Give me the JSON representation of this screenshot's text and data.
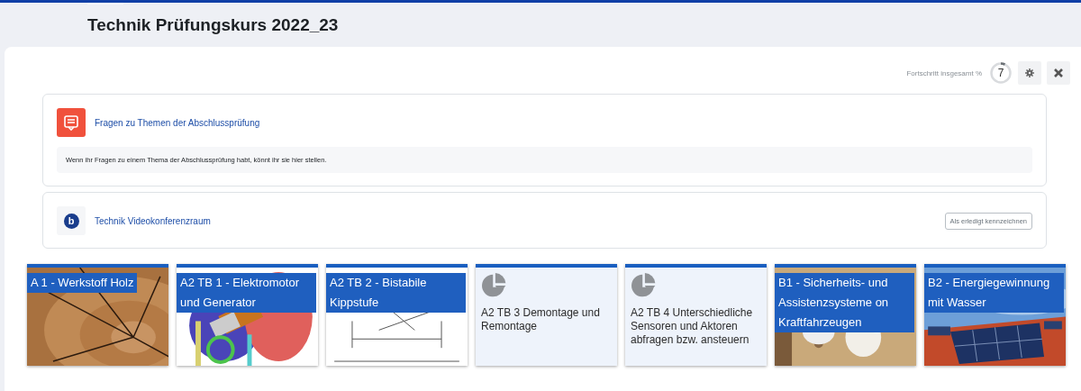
{
  "course": {
    "title": "Technik Prüfungskurs 2022_23"
  },
  "progress": {
    "label": "Fortschritt insgesamt %",
    "value": "7",
    "level": 0.07
  },
  "activities": [
    {
      "kind": "forum",
      "title": "Fragen zu Themen der Abschlussprüfung",
      "description": "Wenn ihr Fragen zu einem Thema der Abschlussprüfung habt, könnt ihr sie hier stellen."
    },
    {
      "kind": "conference",
      "icon_text": "b",
      "title": "Technik Videokonferenzraum",
      "completion_button": "Als erledigt kennzeichnen"
    }
  ],
  "sections": [
    {
      "kind": "picture",
      "title": "A 1 - Werkstoff Holz"
    },
    {
      "kind": "picture",
      "title": "A2 TB 1 - Elektromotor und Generator"
    },
    {
      "kind": "picture",
      "title": "A2 TB 2 - Bistabile Kippstufe"
    },
    {
      "kind": "plain",
      "title": "A2 TB 3 Demontage und Remontage"
    },
    {
      "kind": "plain",
      "title": "A2 TB 4 Unterschiedliche Sensoren und Aktoren abfragen bzw. ansteuern"
    },
    {
      "kind": "picture",
      "title": "B1 - Sicherheits- und Assistenzsysteme on Kraftfahrzeugen"
    },
    {
      "kind": "picture",
      "title": "B2 - Energiegewinnung mit Wasser"
    }
  ]
}
